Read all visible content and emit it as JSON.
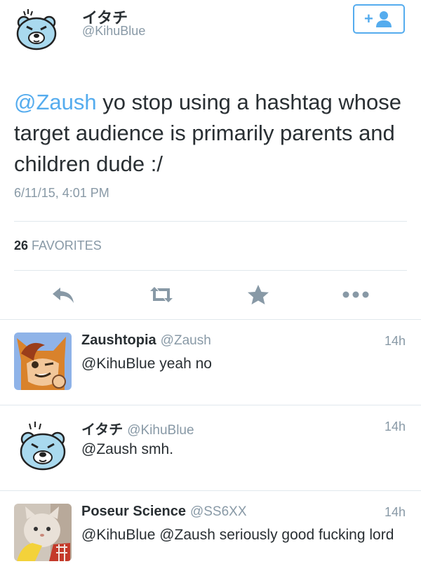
{
  "tweet": {
    "name": "イタチ",
    "handle": "@KihuBlue",
    "mention": "@Zaush",
    "text": " yo stop using a hashtag whose target audience is primarily parents and children dude :/",
    "timestamp": "6/11/15, 4:01 PM",
    "favorites_count": "26",
    "favorites_label": "FAVORITES",
    "follow_icon": "add-user-icon",
    "follow_label": "+"
  },
  "actions": [
    {
      "icon": "reply-icon"
    },
    {
      "icon": "retweet-icon"
    },
    {
      "icon": "star-icon"
    },
    {
      "icon": "more-icon"
    }
  ],
  "replies": [
    {
      "name": "Zaushtopia",
      "handle": "@Zaush",
      "time": "14h",
      "text": "@KihuBlue yeah no",
      "avatar": "fox-avatar"
    },
    {
      "name": "イタチ",
      "handle": "@KihuBlue",
      "time": "14h",
      "text": "@Zaush smh.",
      "avatar": "bear-avatar"
    },
    {
      "name": "Poseur Science",
      "handle": "@SS6XX",
      "time": "14h",
      "text": "@KihuBlue @Zaush seriously good fucking lord",
      "avatar": "cat-avatar"
    }
  ],
  "colors": {
    "accent": "#55acee",
    "muted": "#8899a6",
    "text": "#292f33",
    "divider": "#e1e8ed",
    "avatar_blue": "#a9d9ee"
  }
}
